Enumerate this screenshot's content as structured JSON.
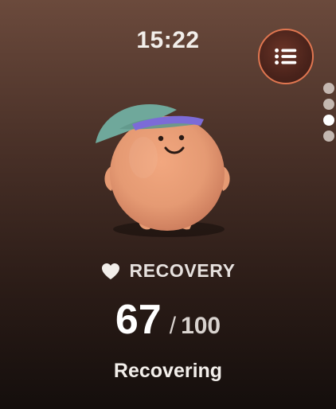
{
  "time": "15:22",
  "menu": {
    "icon": "list-icon",
    "accent": "#E07650"
  },
  "pagination": {
    "count": 4,
    "active_index": 2
  },
  "mascot": {
    "icon": "peach-mascot-with-cap-and-headband"
  },
  "recovery": {
    "label": "RECOVERY",
    "icon": "heart-icon",
    "score": "67",
    "separator": "/",
    "max": "100",
    "status": "Recovering"
  }
}
